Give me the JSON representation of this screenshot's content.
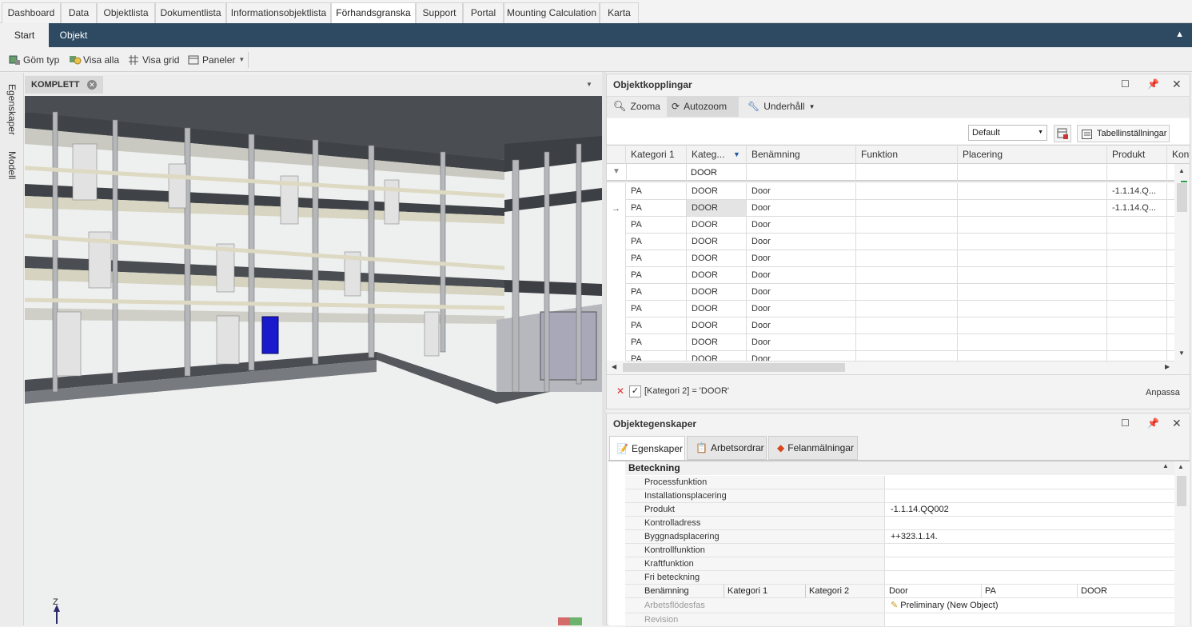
{
  "top_tabs": [
    "Dashboard",
    "Data",
    "Objektlista",
    "Dokumentlista",
    "Informationsobjektlista",
    "Förhandsgranska",
    "Support",
    "Portal",
    "Mounting Calculation",
    "Karta"
  ],
  "ribbon_tabs": [
    "Start",
    "Objekt"
  ],
  "toolbar": {
    "hide_type": "Göm typ",
    "show_all": "Visa alla",
    "show_grid": "Visa grid",
    "panels": "Paneler"
  },
  "side_tabs": {
    "properties": "Egenskaper",
    "model": "Modell"
  },
  "viewport": {
    "tab_label": "KOMPLETT",
    "axis_label": "Z"
  },
  "links_panel": {
    "title": "Objektkopplingar",
    "tools": {
      "zoom": "Zooma",
      "autozoom": "Autozoom",
      "maintenance": "Underhåll"
    },
    "layout_select": "Default",
    "table_settings": "Tabellinställningar",
    "columns": [
      "Kategori 1",
      "Kateg...",
      "Benämning",
      "Funktion",
      "Placering",
      "Produkt",
      "Kont"
    ],
    "filter_value": "DOOR",
    "rows": [
      {
        "k1": "PA",
        "k2": "DOOR",
        "name": "Door",
        "produkt": "-1.1.14.Q..."
      },
      {
        "k1": "PA",
        "k2": "DOOR",
        "name": "Door",
        "produkt": "-1.1.14.Q..."
      },
      {
        "k1": "PA",
        "k2": "DOOR",
        "name": "Door",
        "produkt": ""
      },
      {
        "k1": "PA",
        "k2": "DOOR",
        "name": "Door",
        "produkt": ""
      },
      {
        "k1": "PA",
        "k2": "DOOR",
        "name": "Door",
        "produkt": ""
      },
      {
        "k1": "PA",
        "k2": "DOOR",
        "name": "Door",
        "produkt": ""
      },
      {
        "k1": "PA",
        "k2": "DOOR",
        "name": "Door",
        "produkt": ""
      },
      {
        "k1": "PA",
        "k2": "DOOR",
        "name": "Door",
        "produkt": ""
      },
      {
        "k1": "PA",
        "k2": "DOOR",
        "name": "Door",
        "produkt": ""
      },
      {
        "k1": "PA",
        "k2": "DOOR",
        "name": "Door",
        "produkt": ""
      },
      {
        "k1": "PA",
        "k2": "DOOR",
        "name": "Door",
        "produkt": ""
      }
    ],
    "filter_expression": "[Kategori 2] = 'DOOR'",
    "customize": "Anpassa"
  },
  "props_panel": {
    "title": "Objektegenskaper",
    "tabs": [
      "Egenskaper",
      "Arbetsordrar",
      "Felanmälningar"
    ],
    "group": "Beteckning",
    "fields": [
      {
        "name": "Processfunktion",
        "value": ""
      },
      {
        "name": "Installationsplacering",
        "value": ""
      },
      {
        "name": "Produkt",
        "value": "-1.1.14.QQ002"
      },
      {
        "name": "Kontrolladress",
        "value": ""
      },
      {
        "name": "Byggnadsplacering",
        "value": "++323.1.14."
      },
      {
        "name": "Kontrollfunktion",
        "value": ""
      },
      {
        "name": "Kraftfunktion",
        "value": ""
      },
      {
        "name": "Fri beteckning",
        "value": ""
      }
    ],
    "multi": {
      "labels": [
        "Benämning",
        "Kategori 1",
        "Kategori 2"
      ],
      "values": [
        "Door",
        "PA",
        "DOOR"
      ]
    },
    "workflow": {
      "label": "Arbetsflödesfas",
      "value": "Preliminary (New Object)"
    },
    "revision": {
      "label": "Revision",
      "value": ""
    }
  },
  "colors": {
    "ribbon": "#2e4a63",
    "accent_blue": "#1f5aa6",
    "highlight_door": "#1a1acc"
  }
}
